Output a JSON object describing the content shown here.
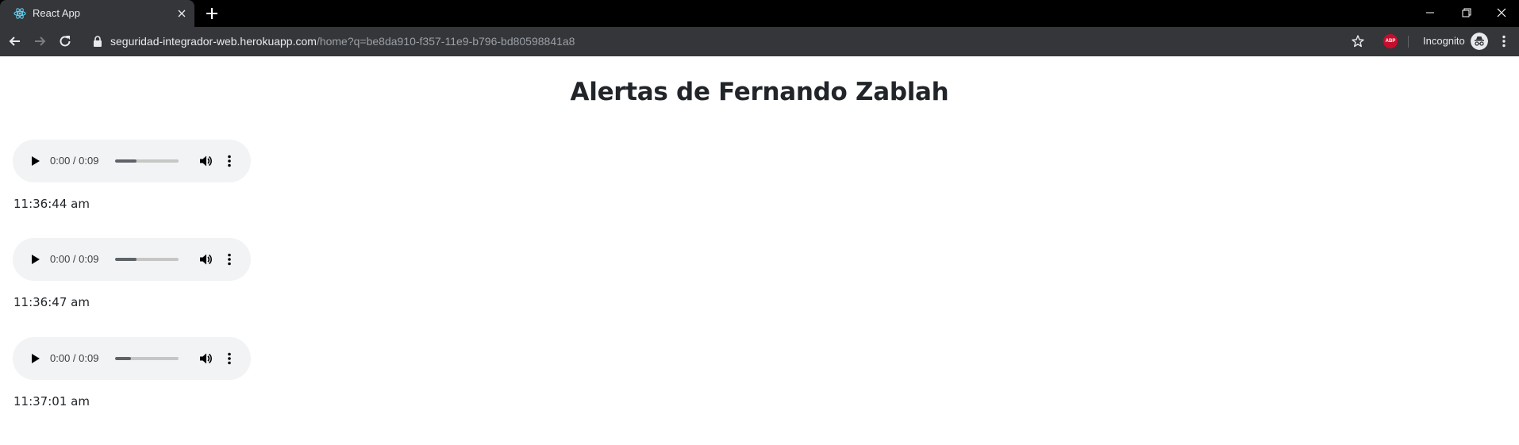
{
  "browser": {
    "tab_title": "React App",
    "url_host": "seguridad-integrador-web.herokuapp.com",
    "url_path": "/home?q=be8da910-f357-11e9-b796-bd80598841a8",
    "extension_label": "ABP",
    "incognito_label": "Incognito"
  },
  "page": {
    "title": "Alertas de Fernando Zablah"
  },
  "alerts": [
    {
      "time_display": "0:00 / 0:09",
      "played_fraction": 0.34,
      "timestamp": "11:36:44 am"
    },
    {
      "time_display": "0:00 / 0:09",
      "played_fraction": 0.34,
      "timestamp": "11:36:47 am"
    },
    {
      "time_display": "0:00 / 0:09",
      "played_fraction": 0.25,
      "timestamp": "11:37:01 am"
    }
  ],
  "colors": {
    "titlebar": "#000000",
    "toolbar": "#35363a",
    "react_logo": "#61dafb",
    "abp_badge": "#c70d2c",
    "player_bg": "#f1f3f4"
  }
}
